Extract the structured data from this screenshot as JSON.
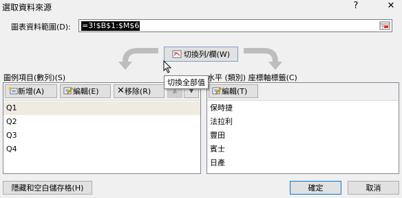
{
  "window": {
    "title": "選取資料來源",
    "help": "?",
    "close": "✕"
  },
  "range": {
    "label": "圖表資料範圍(D):",
    "value": "=3!$B$1:$M$6"
  },
  "switch": {
    "label": "切換列/欄(W)",
    "tooltip": "切換全部值"
  },
  "legend": {
    "label": "圖例項目(數列)(S)",
    "add": "新增(A)",
    "edit": "編輯(E)",
    "remove": "移除(R)",
    "items": [
      "Q1",
      "Q2",
      "Q3",
      "Q4"
    ]
  },
  "axis": {
    "label": "水平 (類別) 座標軸標籤(C)",
    "edit": "編輯(T)",
    "items": [
      "保時捷",
      "法拉利",
      "豐田",
      "賓士",
      "日產"
    ]
  },
  "footer": {
    "hidden_cells": "隱藏和空白儲存格(H)",
    "ok": "確定",
    "cancel": "取消"
  }
}
